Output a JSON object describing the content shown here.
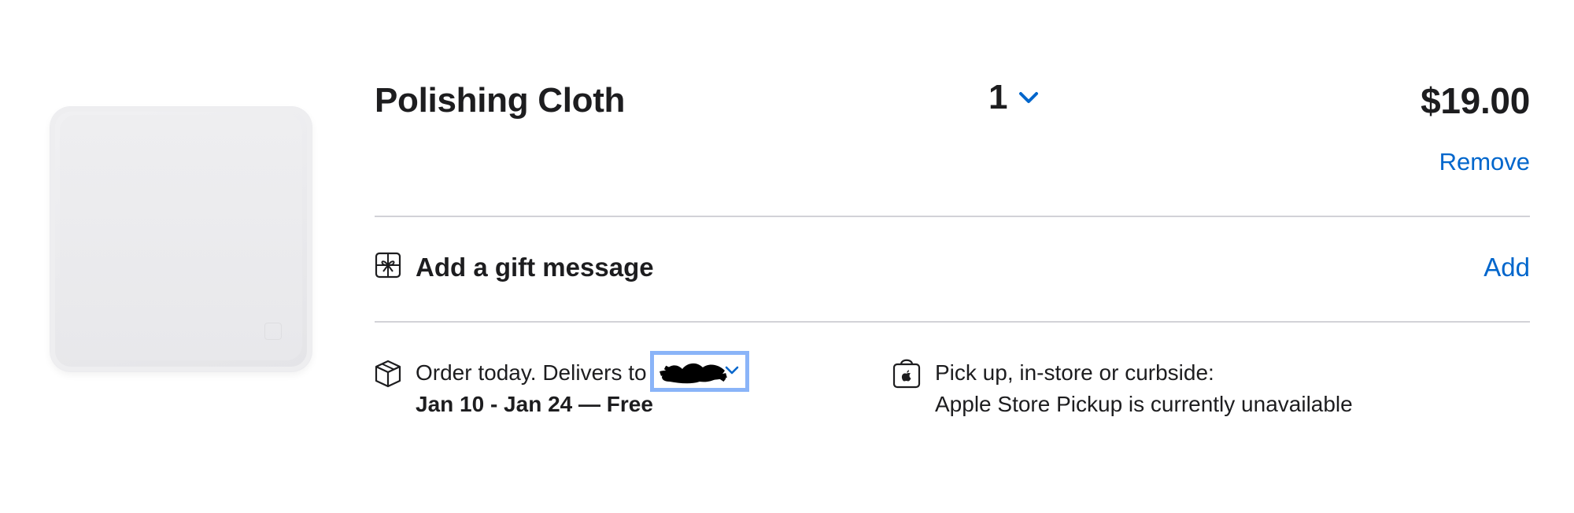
{
  "product": {
    "name": "Polishing Cloth",
    "quantity": "1",
    "price": "$19.00",
    "remove_label": "Remove"
  },
  "gift": {
    "label": "Add a gift message",
    "add_label": "Add"
  },
  "delivery": {
    "prefix": "Order today. Delivers to",
    "location": "",
    "dates": "Jan 10 - Jan 24 — Free"
  },
  "pickup": {
    "title": "Pick up, in-store or curbside:",
    "status": "Apple Store Pickup is currently unavailable"
  },
  "colors": {
    "accent": "#0066cc",
    "text": "#1d1d1f",
    "divider": "#d2d2d7",
    "focus_ring": "#8ab4f8"
  },
  "icons": {
    "quantity": "chevron-down-icon",
    "gift": "gift-icon",
    "delivery": "box-icon",
    "pickup": "shopping-bag-icon",
    "location": "chevron-down-icon"
  }
}
